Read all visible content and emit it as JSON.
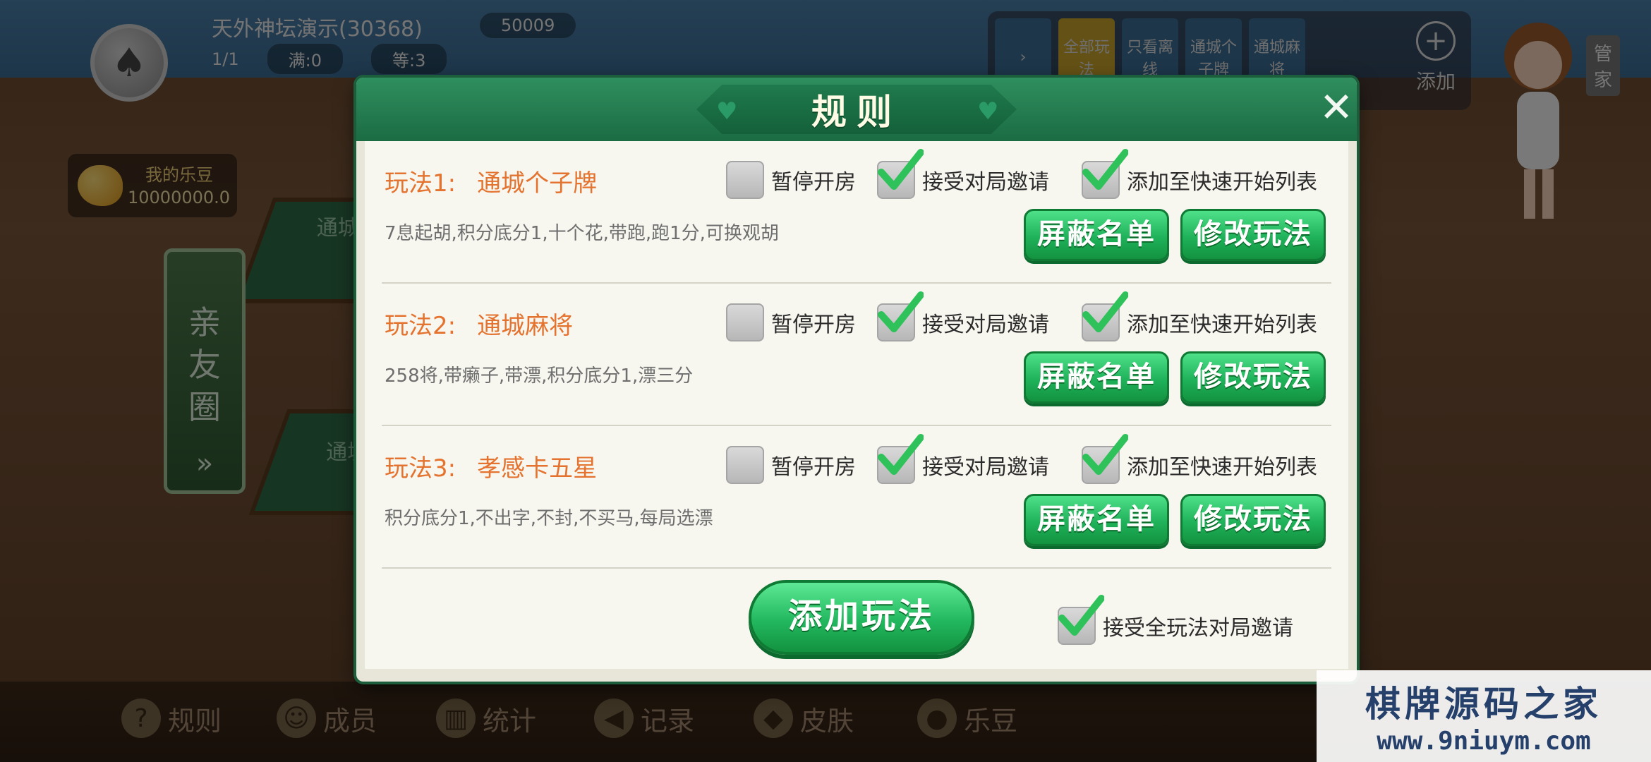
{
  "background": {
    "room_name": "天外神坛演示(30368)",
    "players": "1/1",
    "full": "满:0",
    "waiting": "等:3",
    "diamonds": "50009",
    "ledou_label": "我的乐豆",
    "ledou_value": "10000000.0",
    "friend_circle": "亲友圈",
    "table_labels": [
      "通城个",
      "通城"
    ],
    "top_tabs": [
      "全部玩法",
      "只看离线",
      "通城个子牌",
      "通城麻将"
    ],
    "add_label": "添加",
    "manager_label": "管家"
  },
  "dialog": {
    "title": "规则",
    "close": "✕"
  },
  "rules": [
    {
      "label": "玩法1:",
      "name": "通城个子牌",
      "desc": "7息起胡,积分底分1,十个花,带跑,跑1分,可换观胡",
      "pause": {
        "label": "暂停开房",
        "checked": false
      },
      "accept_invite": {
        "label": "接受对局邀请",
        "checked": true
      },
      "quick_list": {
        "label": "添加至快速开始列表",
        "checked": true
      },
      "block_btn": "屏蔽名单",
      "edit_btn": "修改玩法"
    },
    {
      "label": "玩法2:",
      "name": "通城麻将",
      "desc": "258将,带癞子,带漂,积分底分1,漂三分",
      "pause": {
        "label": "暂停开房",
        "checked": false
      },
      "accept_invite": {
        "label": "接受对局邀请",
        "checked": true
      },
      "quick_list": {
        "label": "添加至快速开始列表",
        "checked": true
      },
      "block_btn": "屏蔽名单",
      "edit_btn": "修改玩法"
    },
    {
      "label": "玩法3:",
      "name": "孝感卡五星",
      "desc": "积分底分1,不出字,不封,不买马,每局选漂",
      "pause": {
        "label": "暂停开房",
        "checked": false
      },
      "accept_invite": {
        "label": "接受对局邀请",
        "checked": true
      },
      "quick_list": {
        "label": "添加至快速开始列表",
        "checked": true
      },
      "block_btn": "屏蔽名单",
      "edit_btn": "修改玩法"
    }
  ],
  "footer": {
    "add_rule_btn": "添加玩法",
    "accept_all": {
      "label": "接受全玩法对局邀请",
      "checked": true
    }
  },
  "bottom_nav": [
    {
      "label": "规则",
      "icon": "question-icon"
    },
    {
      "label": "成员",
      "icon": "members-icon"
    },
    {
      "label": "统计",
      "icon": "stats-icon"
    },
    {
      "label": "记录",
      "icon": "record-icon"
    },
    {
      "label": "皮肤",
      "icon": "skin-icon"
    },
    {
      "label": "乐豆",
      "icon": "bean-icon"
    }
  ],
  "watermark": {
    "line1": "棋牌源码之家",
    "line2": "www.9niuym.com"
  },
  "colors": {
    "accent_green": "#1fb25a",
    "header_green": "#1b6b43",
    "rule_title_orange": "#e4732f"
  }
}
